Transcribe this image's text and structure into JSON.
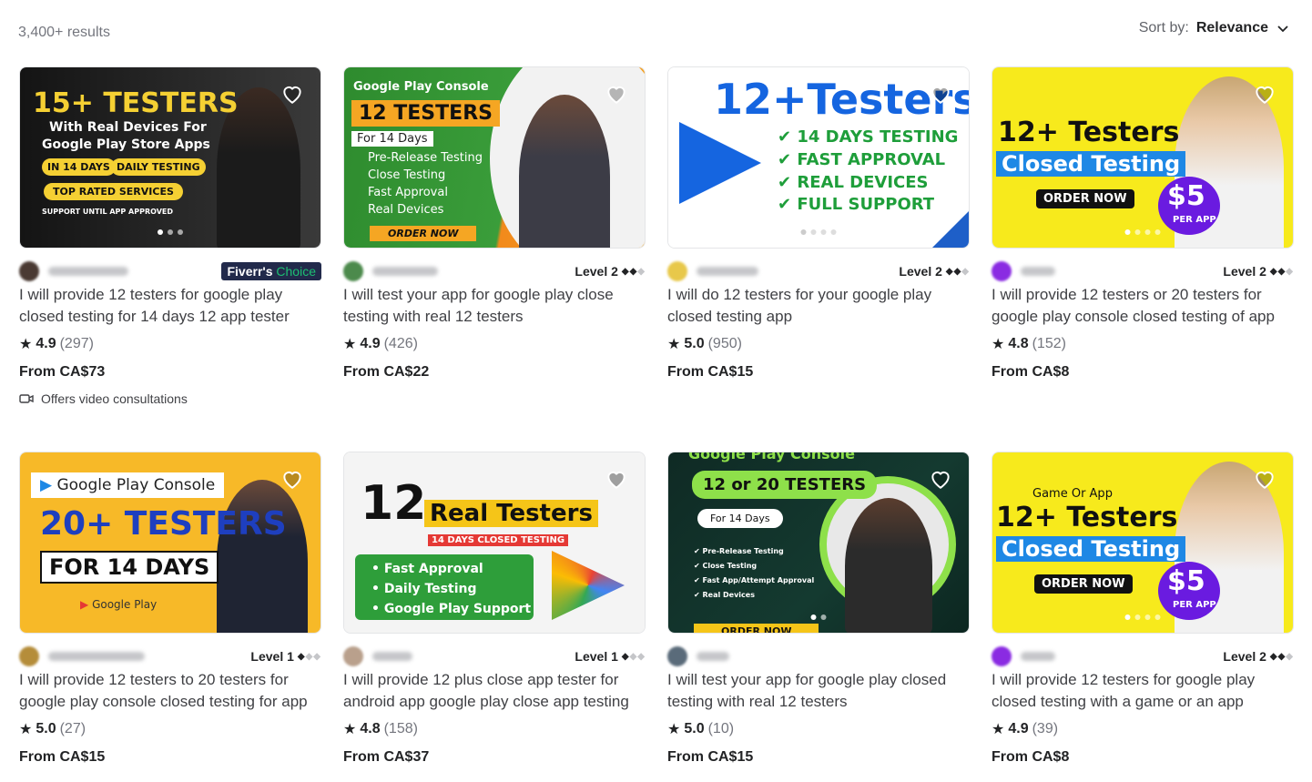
{
  "header": {
    "results": "3,400+ results",
    "sort_label": "Sort by:",
    "sort_value": "Relevance"
  },
  "gigs": [
    {
      "level": "",
      "choice_a": "Fiverr's",
      "choice_b": "Choice",
      "title": "I will provide 12 testers for google play closed testing for 14 days 12 app tester",
      "rating": "4.9",
      "reviews": "(297)",
      "price": "From CA$73",
      "video": "Offers video consultations",
      "thumb": {
        "l1": "15+ TESTERS",
        "l2": "With Real Devices For",
        "l3": "Google Play Store Apps",
        "l4": "IN 14 DAYS",
        "l5": "DAILY TESTING",
        "l6": "TOP RATED SERVICES",
        "l7": "SUPPORT UNTIL APP APPROVED"
      }
    },
    {
      "level": "Level 2",
      "title": "I will test your app for google play close testing with real 12 testers",
      "rating": "4.9",
      "reviews": "(426)",
      "price": "From CA$22",
      "thumb": {
        "l1": "Google Play Console",
        "l2": "12 TESTERS",
        "l3": "For 14 Days",
        "l4": "Pre-Release Testing",
        "l5": "Close Testing",
        "l6": "Fast Approval",
        "l7": "Real Devices",
        "l8": "ORDER NOW"
      }
    },
    {
      "level": "Level 2",
      "title": "I will do 12 testers for your google play closed testing app",
      "rating": "5.0",
      "reviews": "(950)",
      "price": "From CA$15",
      "thumb": {
        "l1": "12+Testers",
        "l2": "14 DAYS TESTING",
        "l3": "FAST APPROVAL",
        "l4": "REAL DEVICES",
        "l5": "FULL SUPPORT"
      }
    },
    {
      "level": "Level 2",
      "title": "I will provide 12 testers or 20 testers for google play console closed testing of app",
      "rating": "4.8",
      "reviews": "(152)",
      "price": "From CA$8",
      "thumb": {
        "l1": "12+ Testers",
        "l2": "Closed Testing",
        "l3": "ORDER NOW",
        "l4": "$5",
        "l5": "PER APP"
      }
    },
    {
      "level": "Level 1",
      "title": "I will provide 12 testers to 20 testers for google play console closed testing for app",
      "rating": "5.0",
      "reviews": "(27)",
      "price": "From CA$15",
      "thumb": {
        "l1": "Google Play Console",
        "l2": "20+ TESTERS",
        "l3": "FOR 14 DAYS",
        "l4": "Google Play"
      }
    },
    {
      "level": "Level 1",
      "title": "I will provide 12 plus close app tester for android app google play close app testing",
      "rating": "4.8",
      "reviews": "(158)",
      "price": "From CA$37",
      "thumb": {
        "l1": "12",
        "l2": "Real Testers",
        "l3": "14 DAYS CLOSED TESTING",
        "l4": "Fast Approval",
        "l5": "Daily Testing",
        "l6": "Google Play Support"
      }
    },
    {
      "level": "",
      "title": "I will test your app for google play closed testing with real 12 testers",
      "rating": "5.0",
      "reviews": "(10)",
      "price": "From CA$15",
      "thumb": {
        "l1": "Google Play Console",
        "l2": "12 or 20 TESTERS",
        "l3": "For 14 Days",
        "l4": "Pre-Release Testing",
        "l5": "Close Testing",
        "l6": "Fast App/Attempt Approval",
        "l7": "Real Devices",
        "l8": "ORDER NOW"
      }
    },
    {
      "level": "Level 2",
      "title": "I will provide 12 testers for google play closed testing with a game or an app",
      "rating": "4.9",
      "reviews": "(39)",
      "price": "From CA$8",
      "thumb": {
        "l0": "Game Or App",
        "l1": "12+ Testers",
        "l2": "Closed Testing",
        "l3": "ORDER NOW",
        "l4": "$5",
        "l5": "PER APP"
      }
    }
  ]
}
